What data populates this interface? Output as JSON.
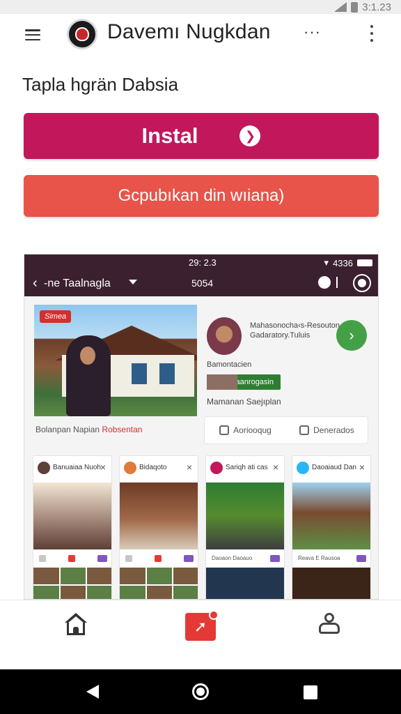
{
  "status_bar": {
    "time": "3:1.23"
  },
  "app_bar": {
    "title": "Davemı Nugkdan",
    "title_more": "···"
  },
  "subtitle": "Tapla hgrän Dabsia",
  "buttons": {
    "install_label": "Instal",
    "install_icon": "arrow-right-icon",
    "open_label": "Gcpubıkan din wıiana)"
  },
  "colors": {
    "install": "#c2185b",
    "open": "#e8534a",
    "header_dark": "#3b2030",
    "accent_green": "#43a047"
  },
  "screenshot": {
    "status_time": "29: 2.3",
    "status_right": "4336",
    "toolbar_back": "‹",
    "toolbar_name": "-ne Taalnagla",
    "toolbar_mid": "5054",
    "feature_tag": "Simea",
    "feature_caption": "Bolanpan Napian",
    "feature_caption_highlight": "Robsentan",
    "profile": {
      "line1": "Mahasonocha‹s-Resouton",
      "line2": "Gadaratory.Tuluis",
      "name": "Bamontacien",
      "chip": "Baanrogasin",
      "description": "Mamanan Saejıplan",
      "action_left": "Aoriooqug",
      "action_right": "Denerados"
    },
    "cards": [
      {
        "name": "Banuaiaa Nuoh"
      },
      {
        "name": "Bidaqoto"
      },
      {
        "name": "Sariqh ati cas"
      },
      {
        "name": "Daoaiaud Dan"
      }
    ],
    "card_captions": [
      "",
      "",
      "Daoaon Daoauo",
      "Reava E Rausoa"
    ]
  }
}
